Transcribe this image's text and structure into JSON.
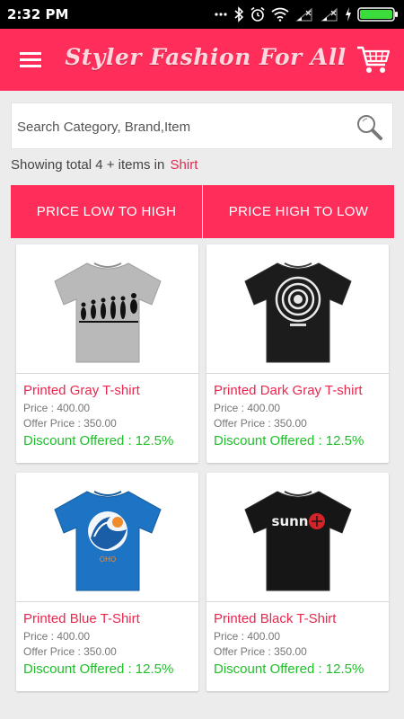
{
  "status_bar": {
    "time": "2:32 PM"
  },
  "app_bar": {
    "title": "Styler Fashion For All"
  },
  "search": {
    "placeholder": "Search Category, Brand,Item"
  },
  "results": {
    "prefix": "Showing total 4 + items  in",
    "category": "Shirt"
  },
  "sort": {
    "low_to_high": "PRICE LOW TO HIGH",
    "high_to_low": "PRICE HIGH TO LOW"
  },
  "products": [
    {
      "name": "Printed Gray T-shirt",
      "price": "Price : 400.00",
      "offer": "Offer Price : 350.00",
      "discount": "Discount Offered : 12.5%",
      "shirt_color": "#b9b9b9",
      "print": "evolution"
    },
    {
      "name": "Printed Dark Gray T-shirt",
      "price": "Price : 400.00",
      "offer": "Offer Price : 350.00",
      "discount": "Discount Offered : 12.5%",
      "shirt_color": "#1c1c1c",
      "print": "circles"
    },
    {
      "name": "Printed Blue T-Shirt",
      "price": "Price : 400.00",
      "offer": "Offer Price : 350.00",
      "discount": "Discount Offered : 12.5%",
      "shirt_color": "#1d74c4",
      "print": "wave"
    },
    {
      "name": "Printed Black T-Shirt",
      "price": "Price : 400.00",
      "offer": "Offer Price : 350.00",
      "discount": "Discount Offered : 12.5%",
      "shirt_color": "#161616",
      "print": "sunn"
    }
  ],
  "colors": {
    "accent": "#ff2d5a",
    "product_name": "#e8284f",
    "discount": "#1fbf2a"
  }
}
